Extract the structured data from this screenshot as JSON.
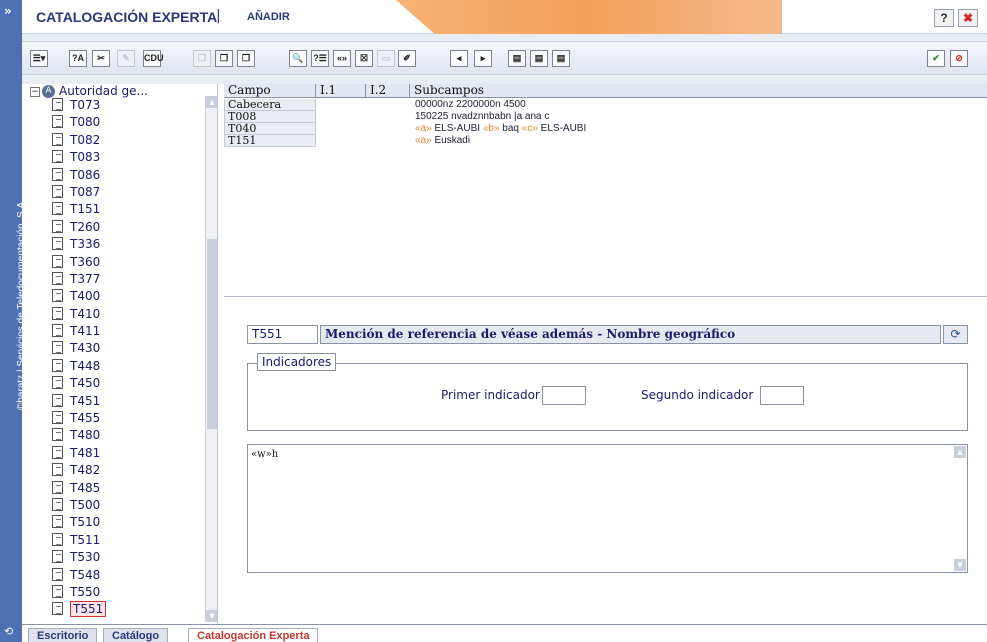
{
  "app": {
    "title": "CATALOGACIÓN EXPERTA",
    "separator": "|",
    "mode": "AÑADIR",
    "help_label": "?",
    "close_label": "✖"
  },
  "sidebar": {
    "expand_label": "»",
    "vertical_text": "©baratz | Servicios de Teledocumentación, S.A.",
    "bottom_icon": "⟲"
  },
  "toolbar": {
    "buttons": [
      {
        "name": "list-menu-icon",
        "label": "☰▾",
        "enabled": true
      },
      {
        "name": "spellcheck-icon",
        "label": "?A",
        "enabled": true
      },
      {
        "name": "scissors-icon",
        "label": "✂",
        "enabled": true
      },
      {
        "name": "format-icon",
        "label": "✎",
        "enabled": false
      },
      {
        "name": "cdu-icon",
        "label": "CDU",
        "enabled": true
      },
      {
        "name": "copy-disabled-icon",
        "label": "❐",
        "enabled": false
      },
      {
        "name": "window-icon",
        "label": "❐",
        "enabled": true
      },
      {
        "name": "window-alt-icon",
        "label": "❐",
        "enabled": true
      },
      {
        "name": "preview-icon",
        "label": "🔍",
        "enabled": true
      },
      {
        "name": "list-numbered-icon",
        "label": "?☰",
        "enabled": true
      },
      {
        "name": "subfield-icon",
        "label": "«»",
        "enabled": true
      },
      {
        "name": "delete-field-icon",
        "label": "☒",
        "enabled": true
      },
      {
        "name": "disabled-icon",
        "label": "▭",
        "enabled": false
      },
      {
        "name": "edit-record-icon",
        "label": "✐",
        "enabled": true
      },
      {
        "name": "prev-icon",
        "label": "◂",
        "enabled": true
      },
      {
        "name": "next-icon",
        "label": "▸",
        "enabled": true
      },
      {
        "name": "layout-1-icon",
        "label": "▤",
        "enabled": true
      },
      {
        "name": "layout-2-icon",
        "label": "▤",
        "enabled": true
      },
      {
        "name": "layout-3-icon",
        "label": "▤",
        "enabled": true
      }
    ],
    "accept_label": "✔",
    "cancel_label": "⊘"
  },
  "tree": {
    "root_toggle": "−",
    "root_label": "Autoridad ge...",
    "items": [
      "T073",
      "T080",
      "T082",
      "T083",
      "T086",
      "T087",
      "T151",
      "T260",
      "T336",
      "T360",
      "T377",
      "T400",
      "T410",
      "T411",
      "T430",
      "T448",
      "T450",
      "T451",
      "T455",
      "T480",
      "T481",
      "T482",
      "T485",
      "T500",
      "T510",
      "T511",
      "T530",
      "T548",
      "T550",
      "T551"
    ],
    "selected": "T551"
  },
  "fields": {
    "headers": [
      "Campo",
      "I.1",
      "I.2",
      "Subcampos"
    ],
    "rows": [
      {
        "campo": "Cabecera",
        "sub": "00000nz 2200000n 4500"
      },
      {
        "campo": "T008",
        "sub": "150225 nvadznnbabn |a ana c"
      },
      {
        "campo": "T040",
        "sub_parts": [
          {
            "code": "«a»",
            "text": " ELS-AUBI "
          },
          {
            "code": "«b»",
            "text": " baq "
          },
          {
            "code": "«c»",
            "text": " ELS-AUBI"
          }
        ]
      },
      {
        "campo": "T151",
        "sub_parts": [
          {
            "code": "«a»",
            "text": " Euskadi"
          }
        ]
      }
    ]
  },
  "editor": {
    "tag": "T551",
    "description": "Mención de referencia de véase además - Nombre geográfico",
    "indicators_legend": "Indicadores",
    "first_indicator_label": "Primer indicador",
    "first_indicator_value": "",
    "second_indicator_label": "Segundo indicador",
    "second_indicator_value": "",
    "content": "«w»h"
  },
  "tabs": [
    {
      "label": "Escritorio",
      "active": false
    },
    {
      "label": "Catálogo",
      "active": false
    },
    {
      "label": "Catalogación Experta",
      "active": true
    }
  ],
  "colors": {
    "accent_blue": "#4e71b5",
    "header_orange": "#f4a05a",
    "title_navy": "#29387d",
    "active_tab_red": "#c0392b"
  }
}
